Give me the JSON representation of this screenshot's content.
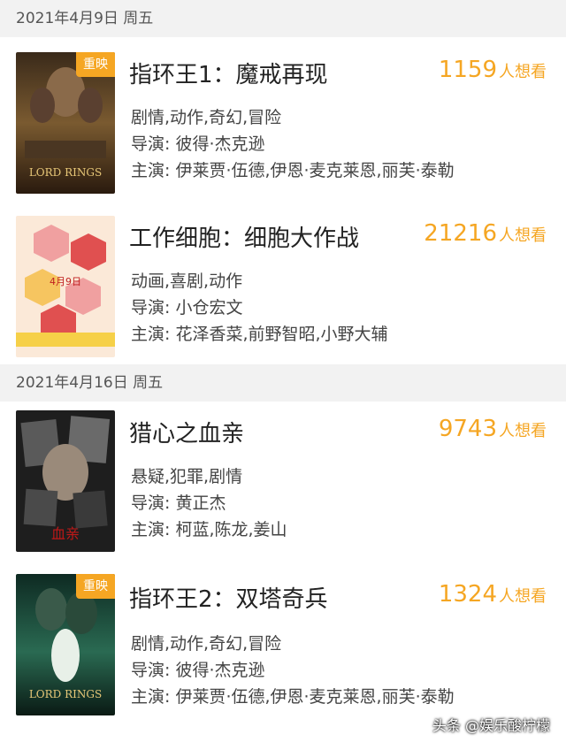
{
  "sections": [
    {
      "date": "2021年4月9日 周五",
      "movies": [
        {
          "title": "指环王1：魔戒再现",
          "rerun": "重映",
          "want_count": "1159",
          "want_label": "人想看",
          "genre": "剧情,动作,奇幻,冒险",
          "director": "导演: 彼得·杰克逊",
          "cast": "主演: 伊莱贾·伍德,伊恩·麦克莱恩,丽芙·泰勒",
          "poster_text": "LORD RINGS"
        },
        {
          "title": "工作细胞：细胞大作战",
          "rerun": "",
          "want_count": "21216",
          "want_label": "人想看",
          "genre": "动画,喜剧,动作",
          "director": "导演: 小仓宏文",
          "cast": "主演: 花泽香菜,前野智昭,小野大辅",
          "poster_text": "4月9日"
        }
      ]
    },
    {
      "date": "2021年4月16日 周五",
      "movies": [
        {
          "title": "猎心之血亲",
          "rerun": "",
          "want_count": "9743",
          "want_label": "人想看",
          "genre": "悬疑,犯罪,剧情",
          "director": "导演: 黄正杰",
          "cast": "主演: 柯蓝,陈龙,姜山",
          "poster_text": "血亲"
        },
        {
          "title": "指环王2：双塔奇兵",
          "rerun": "重映",
          "want_count": "1324",
          "want_label": "人想看",
          "genre": "剧情,动作,奇幻,冒险",
          "director": "导演: 彼得·杰克逊",
          "cast": "主演: 伊莱贾·伍德,伊恩·麦克莱恩,丽芙·泰勒",
          "poster_text": "LORD RINGS"
        }
      ]
    }
  ],
  "watermark": "头条 @娱乐酸柠檬",
  "colors": {
    "accent": "#f5a623",
    "header_bg": "#f2f2f2"
  }
}
